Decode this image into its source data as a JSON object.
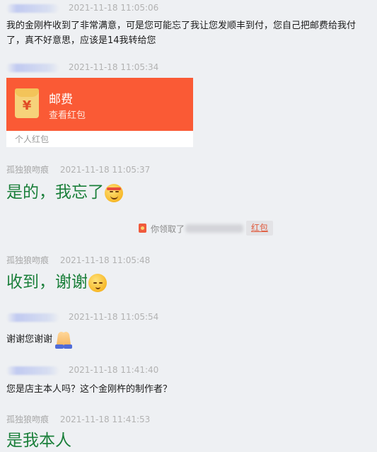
{
  "messages": [
    {
      "time": "2021-11-18 11:05:06",
      "text": "我的金刚杵收到了非常满意，可是您可能忘了我让您发顺丰到付，您自己把邮费给我付了，真不好意思，应该是14我转给您"
    },
    {
      "time": "2021-11-18 11:05:34"
    },
    {
      "name": "孤独狼吻痕",
      "time": "2021-11-18 11:05:37",
      "text": "是的，我忘了"
    },
    {
      "name": "孤独狼吻痕",
      "time": "2021-11-18 11:05:48",
      "text": "收到，谢谢"
    },
    {
      "time": "2021-11-18 11:05:54",
      "text": "谢谢您谢谢"
    },
    {
      "time": "2021-11-18 11:41:40",
      "text": "您是店主本人吗？这个金刚杵的制作者？"
    },
    {
      "name": "孤独狼吻痕",
      "time": "2021-11-18 11:41:53",
      "text": "是我本人"
    }
  ],
  "red_packet": {
    "title": "邮费",
    "subtitle": "查看红包",
    "footer": "个人红包",
    "icon": "red-envelope-icon",
    "color": "#fa5a35"
  },
  "notice": {
    "prefix": "你领取了",
    "link": "红包",
    "icon": "red-envelope-small-icon"
  },
  "colors": {
    "big_text": "#1a7f3a",
    "background": "#eef0f3"
  }
}
